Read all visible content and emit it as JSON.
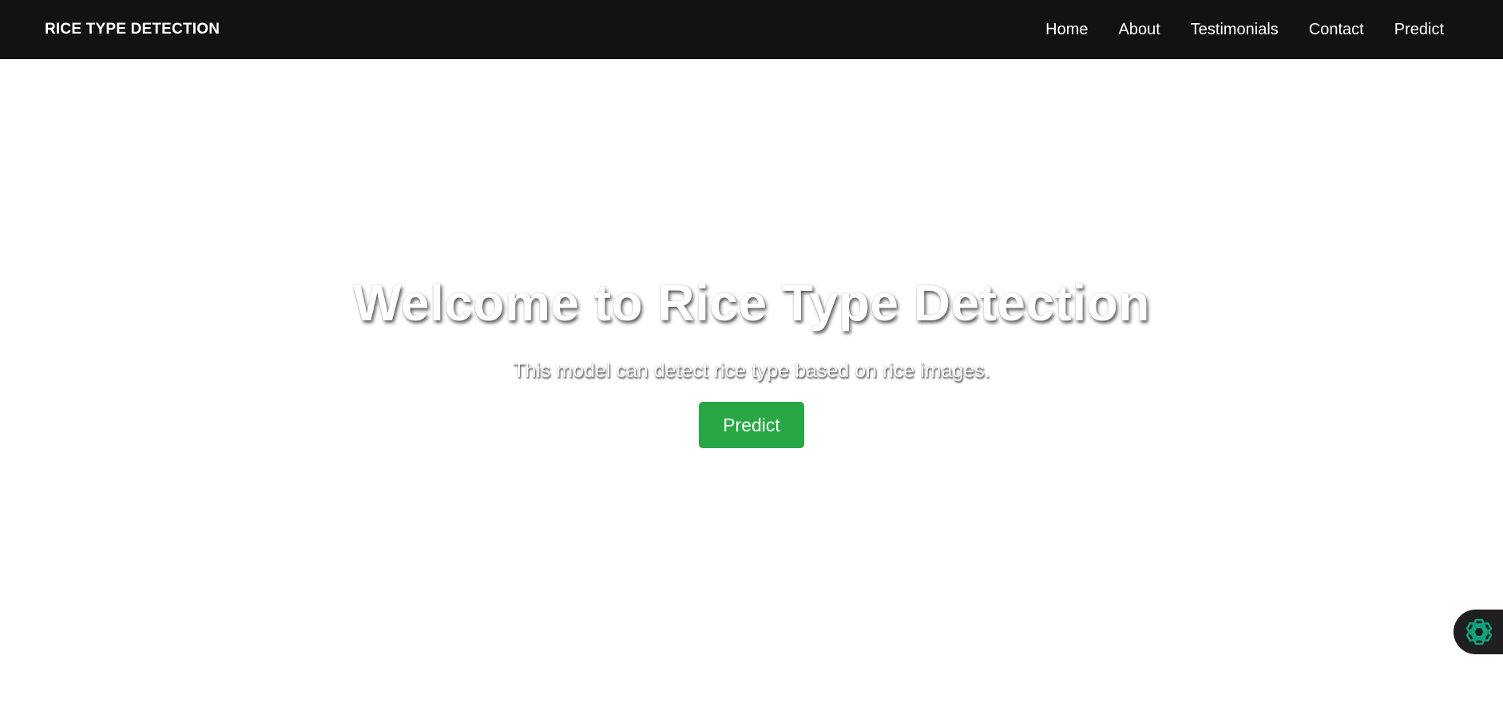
{
  "navbar": {
    "brand": "RICE TYPE DETECTION",
    "links": [
      "Home",
      "About",
      "Testimonials",
      "Contact",
      "Predict"
    ]
  },
  "hero": {
    "title": "Welcome to Rice Type Detection",
    "subtitle": "This model can detect rice type based on rice images.",
    "button_label": "Predict"
  },
  "widget": {
    "icon": "openai-logo-icon"
  },
  "colors": {
    "navbar_bg": "#121212",
    "button_bg": "#28a745",
    "widget_icon": "#10a37f"
  }
}
